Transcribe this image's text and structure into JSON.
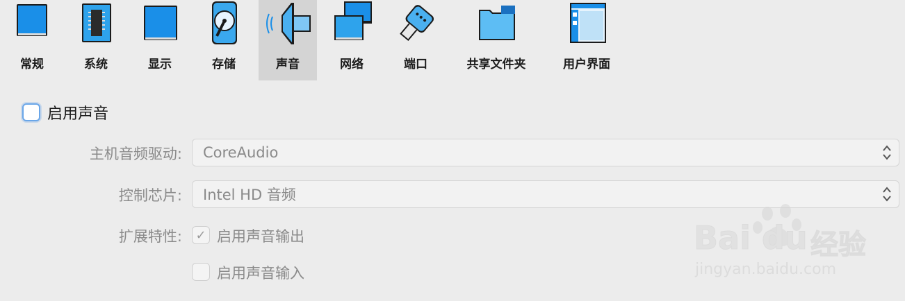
{
  "toolbar": {
    "items": [
      {
        "label": "常规",
        "icon": "general-icon"
      },
      {
        "label": "系统",
        "icon": "system-chip-icon"
      },
      {
        "label": "显示",
        "icon": "display-icon"
      },
      {
        "label": "存储",
        "icon": "storage-disk-icon"
      },
      {
        "label": "声音",
        "icon": "speaker-icon",
        "active": true
      },
      {
        "label": "网络",
        "icon": "network-icon"
      },
      {
        "label": "端口",
        "icon": "serial-port-icon"
      },
      {
        "label": "共享文件夹",
        "icon": "shared-folder-icon"
      },
      {
        "label": "用户界面",
        "icon": "user-interface-icon"
      }
    ]
  },
  "audio": {
    "enable_label": "启用声音",
    "enable_checked": false,
    "host_driver_label": "主机音频驱动:",
    "host_driver_value": "CoreAudio",
    "controller_label": "控制芯片:",
    "controller_value": "Intel HD 音频",
    "extended_label": "扩展特性:",
    "output_label": "启用声音输出",
    "output_checked": true,
    "input_label": "启用声音输入",
    "input_checked": false
  },
  "watermark": {
    "brand": "Bai du",
    "brand_cn": "经验",
    "url": "jingyan.baidu.com"
  },
  "colors": {
    "icon_blue": "#1a8fe8",
    "active_tab_bg": "#d4d4d4",
    "disabled_text": "#8a8a8a"
  }
}
